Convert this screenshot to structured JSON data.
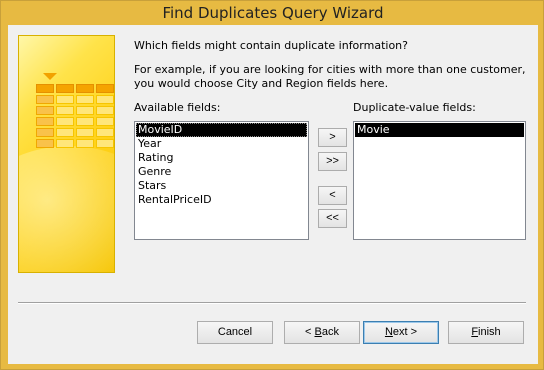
{
  "window": {
    "title": "Find Duplicates Query Wizard"
  },
  "prompt": {
    "question": "Which fields might contain duplicate information?",
    "example": "For example, if you are looking for cities with more than one customer, you would choose City and Region fields here."
  },
  "available": {
    "label": "Available fields:",
    "items": [
      "MovieID",
      "Year",
      "Rating",
      "Genre",
      "Stars",
      "RentalPriceID"
    ],
    "selected": "MovieID"
  },
  "duplicate": {
    "label": "Duplicate-value fields:",
    "items": [
      "Movie"
    ],
    "selected": "Movie"
  },
  "move_buttons": {
    "add_one": ">",
    "add_all": ">>",
    "remove_one": "<",
    "remove_all": "<<"
  },
  "buttons": {
    "cancel": "Cancel",
    "back_prefix": "< ",
    "back_accel": "B",
    "back_rest": "ack",
    "next_accel": "N",
    "next_rest": "ext >",
    "finish_accel": "F",
    "finish_rest": "inish"
  }
}
